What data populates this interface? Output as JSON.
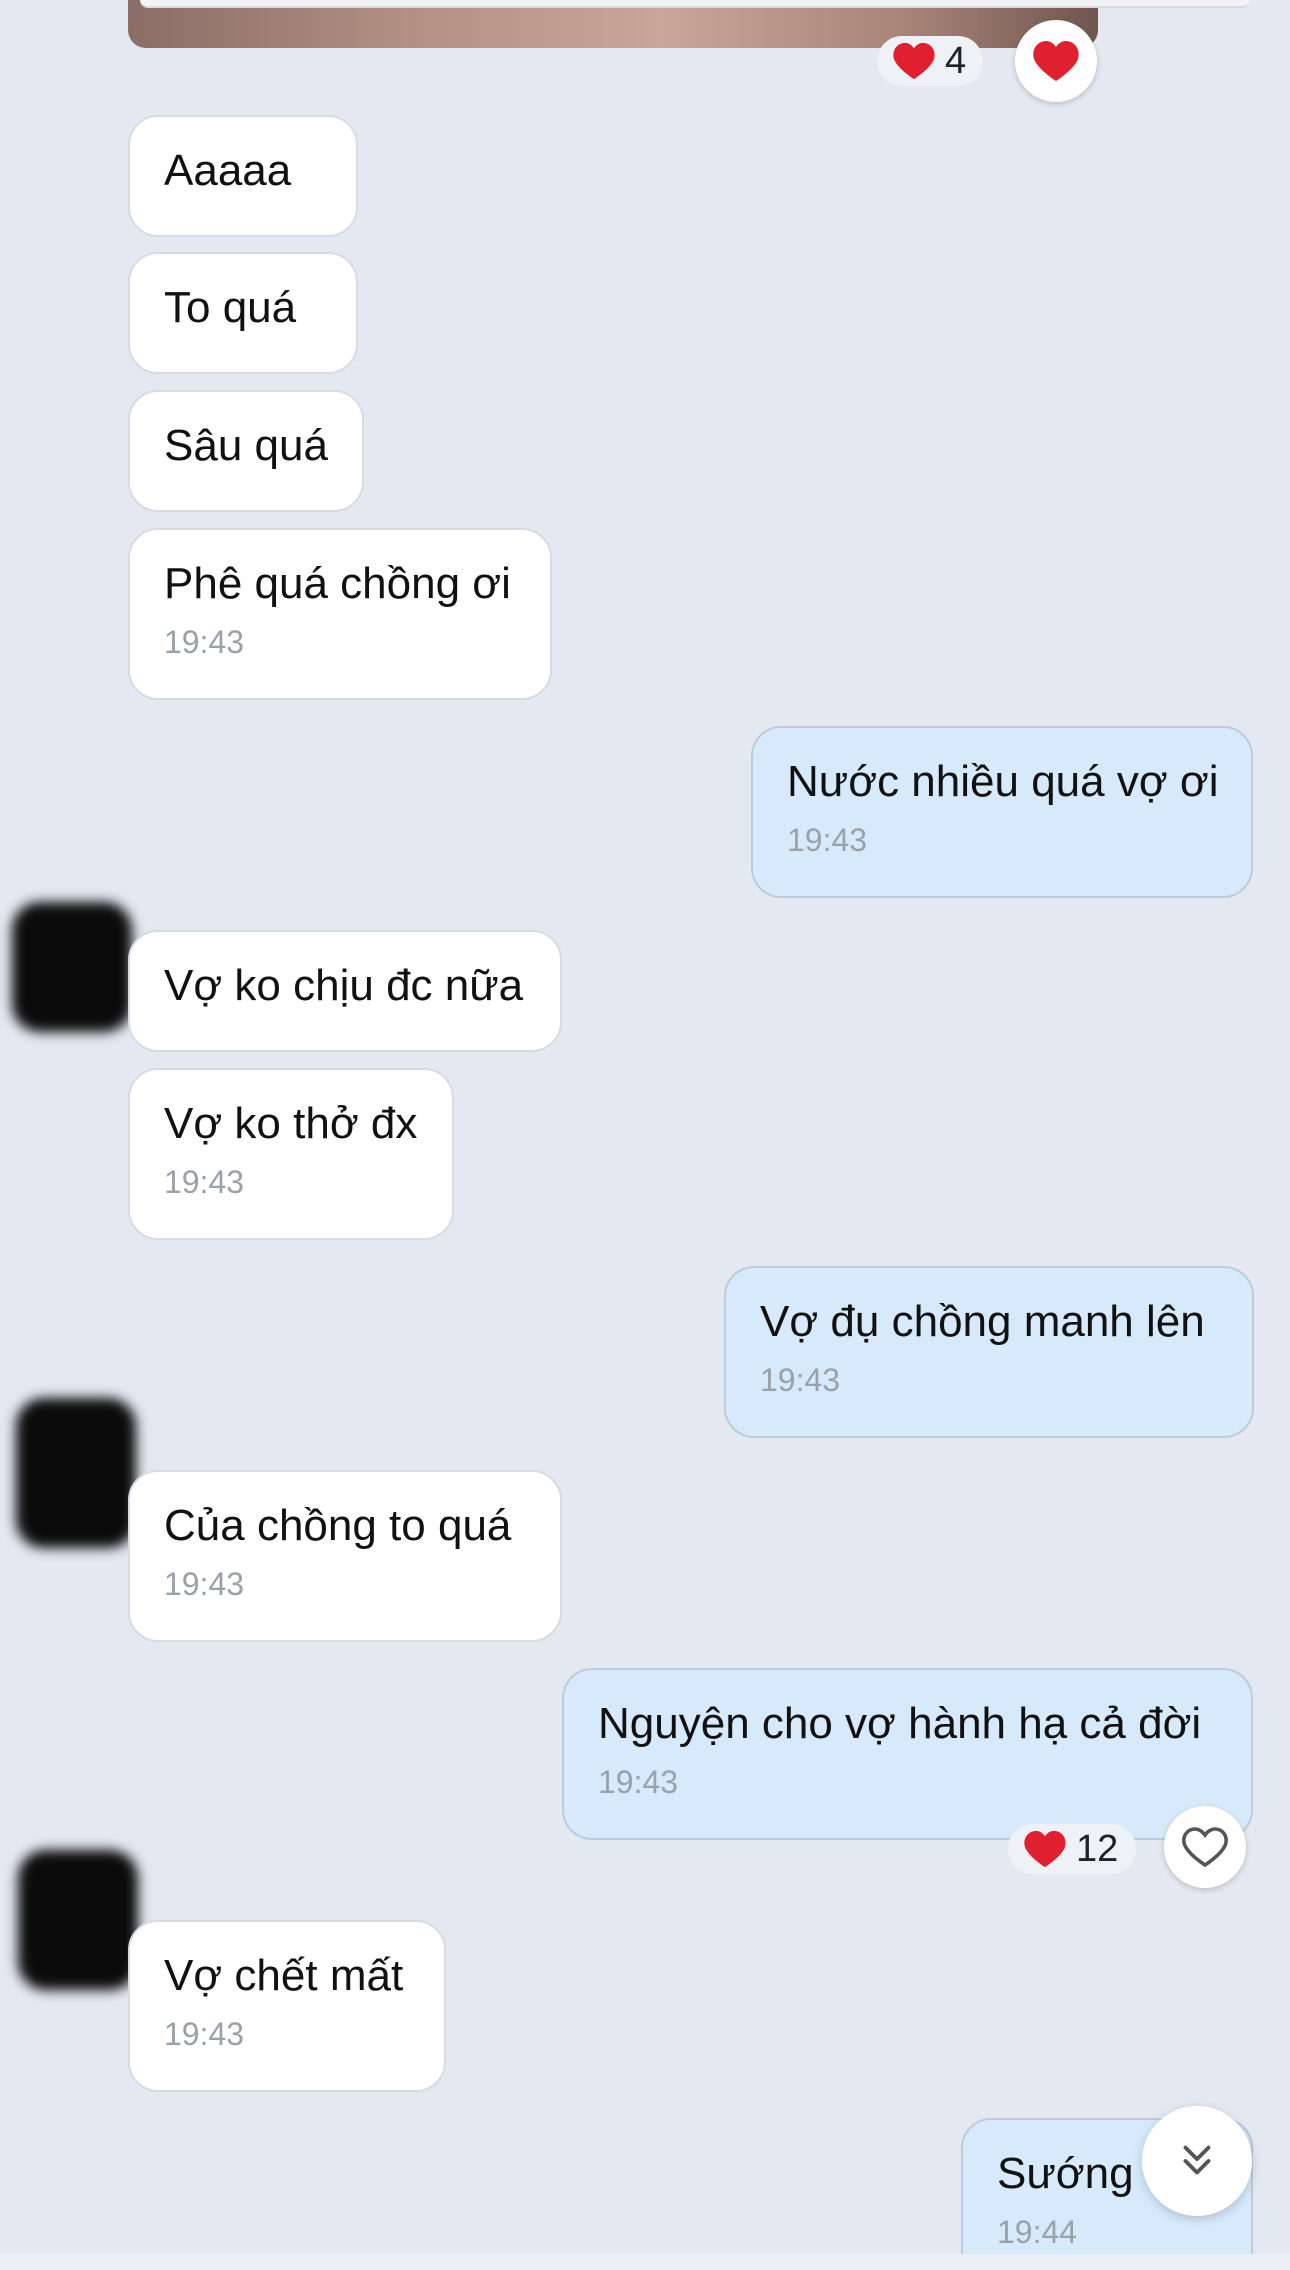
{
  "top_reaction": {
    "emoji": "❤️",
    "count": "4"
  },
  "colors": {
    "background": "#e3e8f1",
    "incoming": "#ffffff",
    "outgoing": "#d6eafb",
    "heart": "#e0202f"
  },
  "icons": {
    "react_filled": "heart-icon",
    "react_outline": "heart-outline-icon",
    "scroll": "double-chevron-down-icon"
  },
  "messages": [
    {
      "id": "m1",
      "dir": "in",
      "text": "Aaaaa",
      "time": ""
    },
    {
      "id": "m2",
      "dir": "in",
      "text": "To quá",
      "time": ""
    },
    {
      "id": "m3",
      "dir": "in",
      "text": "Sâu quá",
      "time": ""
    },
    {
      "id": "m4",
      "dir": "in",
      "text": "Phê quá chồng ơi",
      "time": "19:43"
    },
    {
      "id": "m5",
      "dir": "out",
      "text": "Nước nhiều quá vợ ơi",
      "time": "19:43"
    },
    {
      "id": "m6",
      "dir": "in",
      "text": "Vợ ko chịu đc nữa",
      "time": ""
    },
    {
      "id": "m7",
      "dir": "in",
      "text": "Vợ ko thở đx",
      "time": "19:43"
    },
    {
      "id": "m8",
      "dir": "out",
      "text": "Vợ đụ chồng manh lên",
      "time": "19:43"
    },
    {
      "id": "m9",
      "dir": "in",
      "text": "Của chồng to quá",
      "time": "19:43"
    },
    {
      "id": "m10",
      "dir": "out",
      "text": "Nguyện cho vợ hành hạ cả đời",
      "time": "19:43",
      "reaction": {
        "emoji": "❤️",
        "count": "12"
      }
    },
    {
      "id": "m11",
      "dir": "in",
      "text": "Vợ chết mất",
      "time": "19:43"
    },
    {
      "id": "m12",
      "dir": "out",
      "text": "Sướng",
      "time": "19:44"
    }
  ]
}
